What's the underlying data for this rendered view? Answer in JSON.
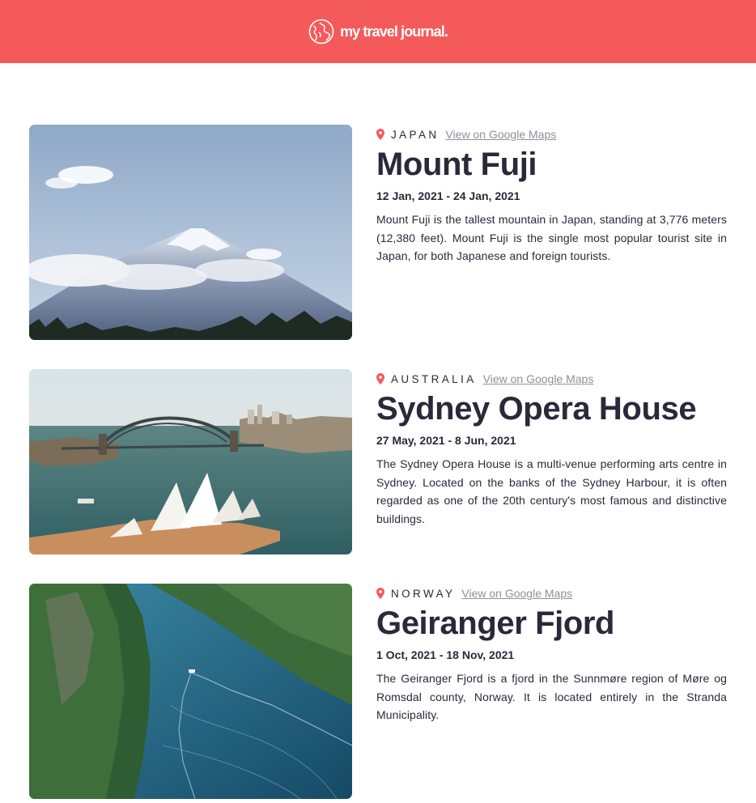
{
  "header": {
    "title": "my travel journal.",
    "icon": "globe-icon",
    "background": "#f55a5a"
  },
  "entries": [
    {
      "country": "JAPAN",
      "map_link": "View on Google Maps",
      "place": "Mount Fuji",
      "dates": "12 Jan, 2021 - 24 Jan, 2021",
      "description": "Mount Fuji is the tallest mountain in Japan, standing at 3,776 meters (12,380 feet). Mount Fuji is the single most popular tourist site in Japan, for both Japanese and foreign tourists."
    },
    {
      "country": "AUSTRALIA",
      "map_link": "View on Google Maps",
      "place": "Sydney Opera House",
      "dates": "27 May, 2021 - 8 Jun, 2021",
      "description": "The Sydney Opera House is a multi-venue performing arts centre in Sydney. Located on the banks of the Sydney Harbour, it is often regarded as one of the 20th century's most famous and distinctive buildings."
    },
    {
      "country": "NORWAY",
      "map_link": "View on Google Maps",
      "place": "Geiranger Fjord",
      "dates": "1 Oct, 2021 - 18 Nov, 2021",
      "description": "The Geiranger Fjord is a fjord in the Sunnmøre region of Møre og Romsdal county, Norway. It is located entirely in the Stranda Municipality."
    }
  ],
  "colors": {
    "accent": "#f55a5a",
    "text": "#2b283a",
    "link": "#918e9b"
  }
}
